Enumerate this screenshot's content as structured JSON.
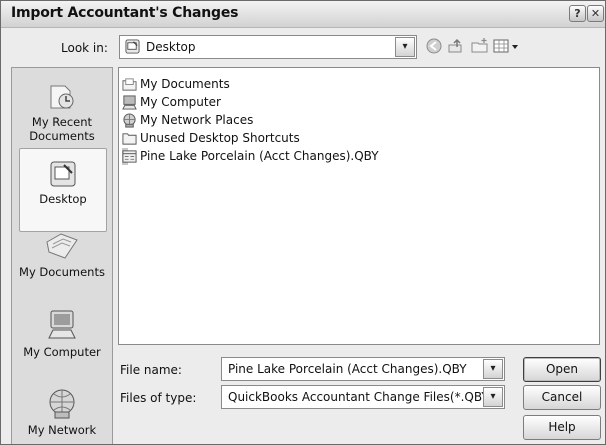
{
  "window": {
    "title": "Import Accountant's Changes",
    "help_glyph": "?",
    "close_glyph": "✕"
  },
  "lookin": {
    "label": "Look in:",
    "value": "Desktop",
    "dropdown_glyph": "▾"
  },
  "places": [
    {
      "label": "My Recent Documents",
      "icon": "recent-documents-icon"
    },
    {
      "label": "Desktop",
      "icon": "desktop-icon"
    },
    {
      "label": "My Documents",
      "icon": "my-documents-icon"
    },
    {
      "label": "My Computer",
      "icon": "my-computer-icon"
    },
    {
      "label": "My Network",
      "icon": "my-network-icon"
    }
  ],
  "files": [
    {
      "name": "My Documents",
      "icon": "folder-documents-icon"
    },
    {
      "name": "My Computer",
      "icon": "computer-icon"
    },
    {
      "name": "My Network Places",
      "icon": "network-places-icon"
    },
    {
      "name": "Unused Desktop Shortcuts",
      "icon": "folder-icon"
    },
    {
      "name": "Pine Lake Porcelain (Acct Changes).QBY",
      "icon": "qby-file-icon",
      "selected": true
    }
  ],
  "filename": {
    "label": "File name:",
    "value": "Pine Lake Porcelain (Acct Changes).QBY"
  },
  "filetype": {
    "label": "Files of type:",
    "value": "QuickBooks Accountant Change Files(*.QBY)"
  },
  "buttons": {
    "open": "Open",
    "cancel": "Cancel",
    "help": "Help"
  }
}
